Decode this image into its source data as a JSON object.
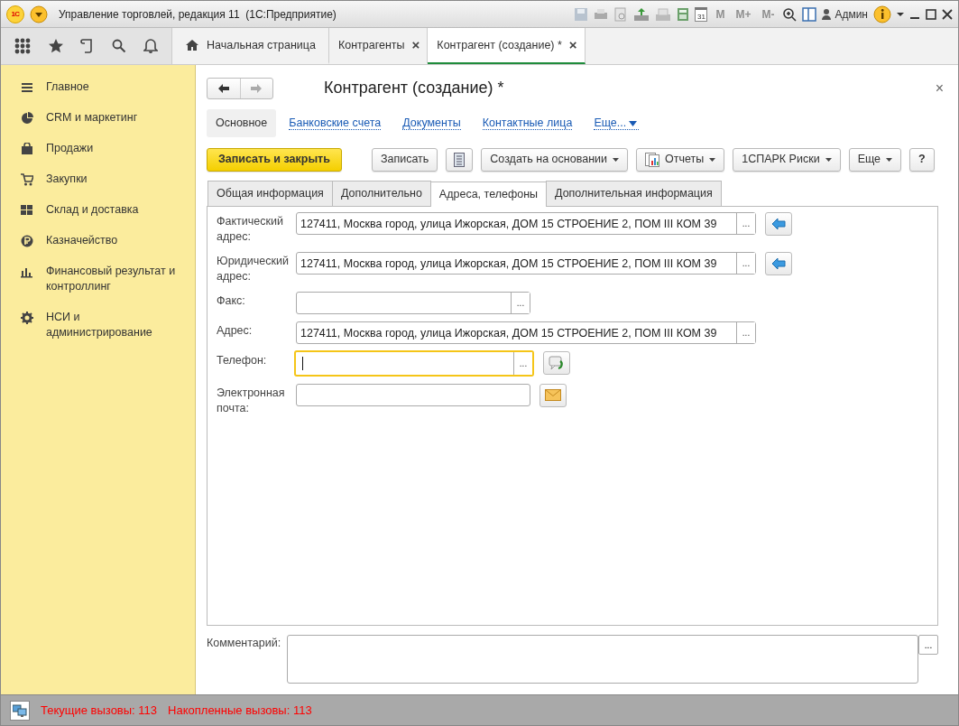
{
  "window": {
    "logo": "1С",
    "title": "Управление торговлей, редакция 11  (1С:Предприятие)",
    "calendar_day": "31",
    "memory_buttons": [
      {
        "label": "M",
        "disabled": true
      },
      {
        "label": "M+",
        "disabled": true
      },
      {
        "label": "M-",
        "disabled": true
      }
    ],
    "user": "Админ"
  },
  "tabs": [
    {
      "label": "Начальная страница",
      "kind": "home",
      "selected": false
    },
    {
      "label": "Контрагенты",
      "close": "×",
      "selected": false
    },
    {
      "label": "Контрагент (создание) *",
      "close": "×",
      "selected": true
    }
  ],
  "sidebar": {
    "items": [
      {
        "label": "Главное"
      },
      {
        "label": "CRM и маркетинг"
      },
      {
        "label": "Продажи"
      },
      {
        "label": "Закупки"
      },
      {
        "label": "Склад и доставка"
      },
      {
        "label": "Казначейство"
      },
      {
        "label": "Финансовый результат и контроллинг"
      },
      {
        "label": "НСИ и администрирование"
      }
    ]
  },
  "form": {
    "title": "Контрагент (создание) *",
    "close": "×",
    "back_enabled": true,
    "forward_enabled": false,
    "sections": [
      {
        "label": "Основное",
        "selected": true
      },
      {
        "label": "Банковские счета",
        "selected": false
      },
      {
        "label": "Документы",
        "selected": false
      },
      {
        "label": "Контактные лица",
        "selected": false
      },
      {
        "label": "Еще...",
        "selected": false,
        "kind": "menu"
      }
    ],
    "commands": [
      {
        "kind": "primary",
        "label": "Записать и закрыть"
      },
      {
        "kind": "plain",
        "label": "Записать"
      },
      {
        "kind": "icon"
      },
      {
        "kind": "menu",
        "label": "Создать на основании"
      },
      {
        "kind": "menu",
        "label": "Отчеты",
        "icon": true
      },
      {
        "kind": "menu",
        "label": "1СПАРК Риски"
      },
      {
        "kind": "menu",
        "label": "Еще"
      },
      {
        "kind": "plain",
        "label": "?"
      }
    ],
    "pages": [
      {
        "label": "Общая информация",
        "selected": false
      },
      {
        "label": "Дополнительно",
        "selected": false
      },
      {
        "label": "Адреса, телефоны",
        "selected": true
      },
      {
        "label": "Дополнительная информация",
        "selected": false
      }
    ],
    "fields": [
      {
        "label": "Фактический адрес:",
        "value": "127411, Москва город, улица Ижорская, ДОМ 15 СТРОЕНИЕ 2, ПОМ III КОМ 39",
        "wide": true,
        "choice": "...",
        "kind": "copy",
        "focused": false
      },
      {
        "label": "Юридический адрес:",
        "value": "127411, Москва город, улица Ижорская, ДОМ 15 СТРОЕНИЕ 2, ПОМ III КОМ 39",
        "wide": true,
        "choice": "...",
        "kind": "copy",
        "focused": false
      },
      {
        "label": "Факс:",
        "wide": false,
        "choice": "...",
        "kind": "plain",
        "focused": false
      },
      {
        "label": "Адрес:",
        "value": "127411, Москва город, улица Ижорская, ДОМ 15 СТРОЕНИЕ 2, ПОМ III КОМ 39",
        "wide": true,
        "choice": "...",
        "kind": "plain",
        "focused": false
      },
      {
        "label": "Телефон:",
        "wide": false,
        "choice": "...",
        "kind": "call",
        "focused": true
      },
      {
        "label": "Электронная почта:",
        "wide": false,
        "kind": "mail",
        "focused": false
      }
    ],
    "comment": {
      "label": "Комментарий:",
      "choice": "..."
    }
  },
  "status_bar": {
    "items": [
      "Текущие вызовы: 113",
      "Накопленные вызовы: 113"
    ]
  }
}
